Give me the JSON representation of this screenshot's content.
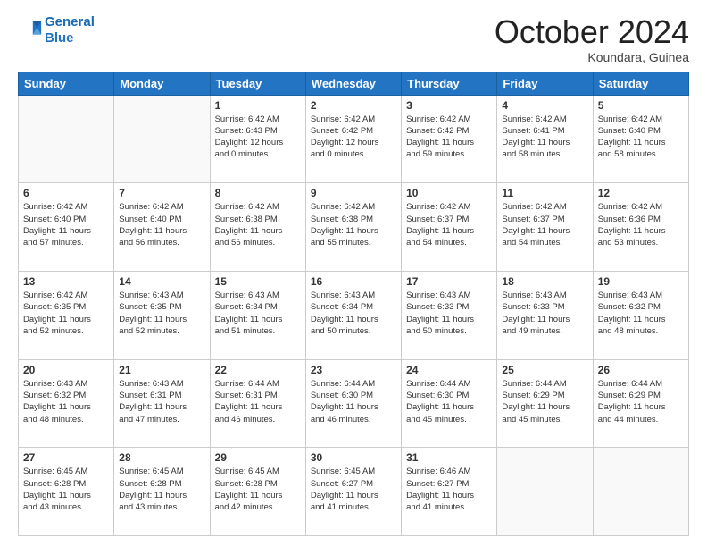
{
  "header": {
    "logo_line1": "General",
    "logo_line2": "Blue",
    "month": "October 2024",
    "location": "Koundara, Guinea"
  },
  "weekdays": [
    "Sunday",
    "Monday",
    "Tuesday",
    "Wednesday",
    "Thursday",
    "Friday",
    "Saturday"
  ],
  "weeks": [
    [
      {
        "day": "",
        "info": ""
      },
      {
        "day": "",
        "info": ""
      },
      {
        "day": "1",
        "info": "Sunrise: 6:42 AM\nSunset: 6:43 PM\nDaylight: 12 hours\nand 0 minutes."
      },
      {
        "day": "2",
        "info": "Sunrise: 6:42 AM\nSunset: 6:42 PM\nDaylight: 12 hours\nand 0 minutes."
      },
      {
        "day": "3",
        "info": "Sunrise: 6:42 AM\nSunset: 6:42 PM\nDaylight: 11 hours\nand 59 minutes."
      },
      {
        "day": "4",
        "info": "Sunrise: 6:42 AM\nSunset: 6:41 PM\nDaylight: 11 hours\nand 58 minutes."
      },
      {
        "day": "5",
        "info": "Sunrise: 6:42 AM\nSunset: 6:40 PM\nDaylight: 11 hours\nand 58 minutes."
      }
    ],
    [
      {
        "day": "6",
        "info": "Sunrise: 6:42 AM\nSunset: 6:40 PM\nDaylight: 11 hours\nand 57 minutes."
      },
      {
        "day": "7",
        "info": "Sunrise: 6:42 AM\nSunset: 6:40 PM\nDaylight: 11 hours\nand 56 minutes."
      },
      {
        "day": "8",
        "info": "Sunrise: 6:42 AM\nSunset: 6:38 PM\nDaylight: 11 hours\nand 56 minutes."
      },
      {
        "day": "9",
        "info": "Sunrise: 6:42 AM\nSunset: 6:38 PM\nDaylight: 11 hours\nand 55 minutes."
      },
      {
        "day": "10",
        "info": "Sunrise: 6:42 AM\nSunset: 6:37 PM\nDaylight: 11 hours\nand 54 minutes."
      },
      {
        "day": "11",
        "info": "Sunrise: 6:42 AM\nSunset: 6:37 PM\nDaylight: 11 hours\nand 54 minutes."
      },
      {
        "day": "12",
        "info": "Sunrise: 6:42 AM\nSunset: 6:36 PM\nDaylight: 11 hours\nand 53 minutes."
      }
    ],
    [
      {
        "day": "13",
        "info": "Sunrise: 6:42 AM\nSunset: 6:35 PM\nDaylight: 11 hours\nand 52 minutes."
      },
      {
        "day": "14",
        "info": "Sunrise: 6:43 AM\nSunset: 6:35 PM\nDaylight: 11 hours\nand 52 minutes."
      },
      {
        "day": "15",
        "info": "Sunrise: 6:43 AM\nSunset: 6:34 PM\nDaylight: 11 hours\nand 51 minutes."
      },
      {
        "day": "16",
        "info": "Sunrise: 6:43 AM\nSunset: 6:34 PM\nDaylight: 11 hours\nand 50 minutes."
      },
      {
        "day": "17",
        "info": "Sunrise: 6:43 AM\nSunset: 6:33 PM\nDaylight: 11 hours\nand 50 minutes."
      },
      {
        "day": "18",
        "info": "Sunrise: 6:43 AM\nSunset: 6:33 PM\nDaylight: 11 hours\nand 49 minutes."
      },
      {
        "day": "19",
        "info": "Sunrise: 6:43 AM\nSunset: 6:32 PM\nDaylight: 11 hours\nand 48 minutes."
      }
    ],
    [
      {
        "day": "20",
        "info": "Sunrise: 6:43 AM\nSunset: 6:32 PM\nDaylight: 11 hours\nand 48 minutes."
      },
      {
        "day": "21",
        "info": "Sunrise: 6:43 AM\nSunset: 6:31 PM\nDaylight: 11 hours\nand 47 minutes."
      },
      {
        "day": "22",
        "info": "Sunrise: 6:44 AM\nSunset: 6:31 PM\nDaylight: 11 hours\nand 46 minutes."
      },
      {
        "day": "23",
        "info": "Sunrise: 6:44 AM\nSunset: 6:30 PM\nDaylight: 11 hours\nand 46 minutes."
      },
      {
        "day": "24",
        "info": "Sunrise: 6:44 AM\nSunset: 6:30 PM\nDaylight: 11 hours\nand 45 minutes."
      },
      {
        "day": "25",
        "info": "Sunrise: 6:44 AM\nSunset: 6:29 PM\nDaylight: 11 hours\nand 45 minutes."
      },
      {
        "day": "26",
        "info": "Sunrise: 6:44 AM\nSunset: 6:29 PM\nDaylight: 11 hours\nand 44 minutes."
      }
    ],
    [
      {
        "day": "27",
        "info": "Sunrise: 6:45 AM\nSunset: 6:28 PM\nDaylight: 11 hours\nand 43 minutes."
      },
      {
        "day": "28",
        "info": "Sunrise: 6:45 AM\nSunset: 6:28 PM\nDaylight: 11 hours\nand 43 minutes."
      },
      {
        "day": "29",
        "info": "Sunrise: 6:45 AM\nSunset: 6:28 PM\nDaylight: 11 hours\nand 42 minutes."
      },
      {
        "day": "30",
        "info": "Sunrise: 6:45 AM\nSunset: 6:27 PM\nDaylight: 11 hours\nand 41 minutes."
      },
      {
        "day": "31",
        "info": "Sunrise: 6:46 AM\nSunset: 6:27 PM\nDaylight: 11 hours\nand 41 minutes."
      },
      {
        "day": "",
        "info": ""
      },
      {
        "day": "",
        "info": ""
      }
    ]
  ]
}
